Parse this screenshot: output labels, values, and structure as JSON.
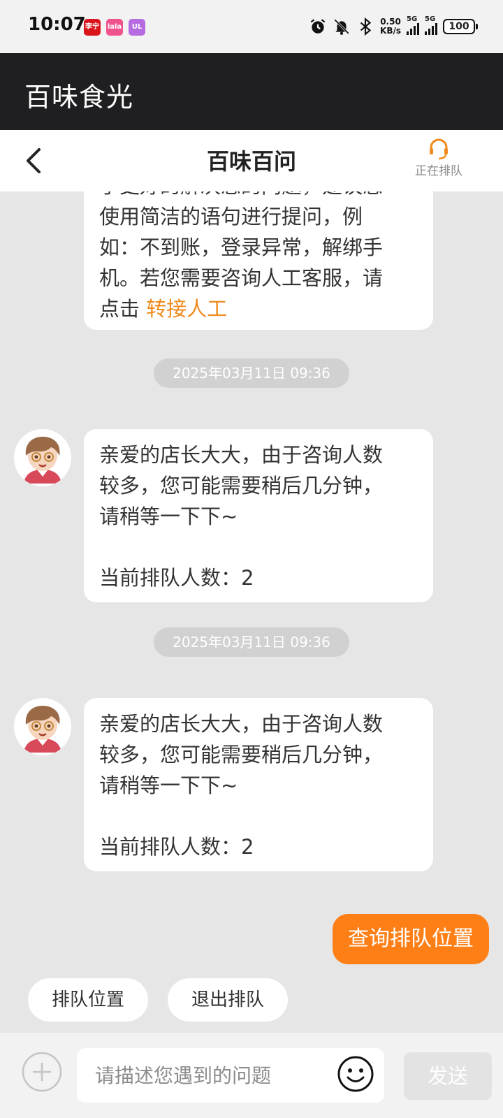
{
  "status_bar": {
    "time": "10:07",
    "badges": [
      "李宁",
      "lala",
      "UL"
    ],
    "net_speed_value": "0.50",
    "net_speed_unit": "KB/s",
    "sim1": "5G",
    "sim2": "5G",
    "battery": "100"
  },
  "app_header": {
    "title": "百味食光"
  },
  "nav": {
    "title": "百味百问",
    "queue_status": "正在排队"
  },
  "chat": {
    "top_bubble": {
      "lines": [
        "了更好的解决您的问题，建议您",
        "使用简洁的语句进行提问，例",
        "如：不到账，登录异常，解绑手",
        "机。若您需要咨询人工客服，请"
      ],
      "last_prefix": "点击 ",
      "link_text": "转接人工"
    },
    "messages": [
      {
        "timestamp": "2025年03月11日 09:36",
        "lines": [
          "亲爱的店长大大，由于咨询人数",
          "较多，您可能需要稍后几分钟，",
          "请稍等一下下~"
        ],
        "queue_line": "当前排队人数：2"
      },
      {
        "timestamp": "2025年03月11日 09:36",
        "lines": [
          "亲爱的店长大大，由于咨询人数",
          "较多，您可能需要稍后几分钟，",
          "请稍等一下下~"
        ],
        "queue_line": "当前排队人数：2"
      }
    ],
    "user_message": "查询排队位置"
  },
  "quick_actions": [
    "排队位置",
    "退出排队"
  ],
  "input": {
    "placeholder": "请描述您遇到的问题",
    "send_label": "发送"
  },
  "colors": {
    "accent": "#ff7f17",
    "link": "#f08a1c",
    "header_bg": "#1f1f21",
    "chat_bg": "#e6e6e6"
  }
}
